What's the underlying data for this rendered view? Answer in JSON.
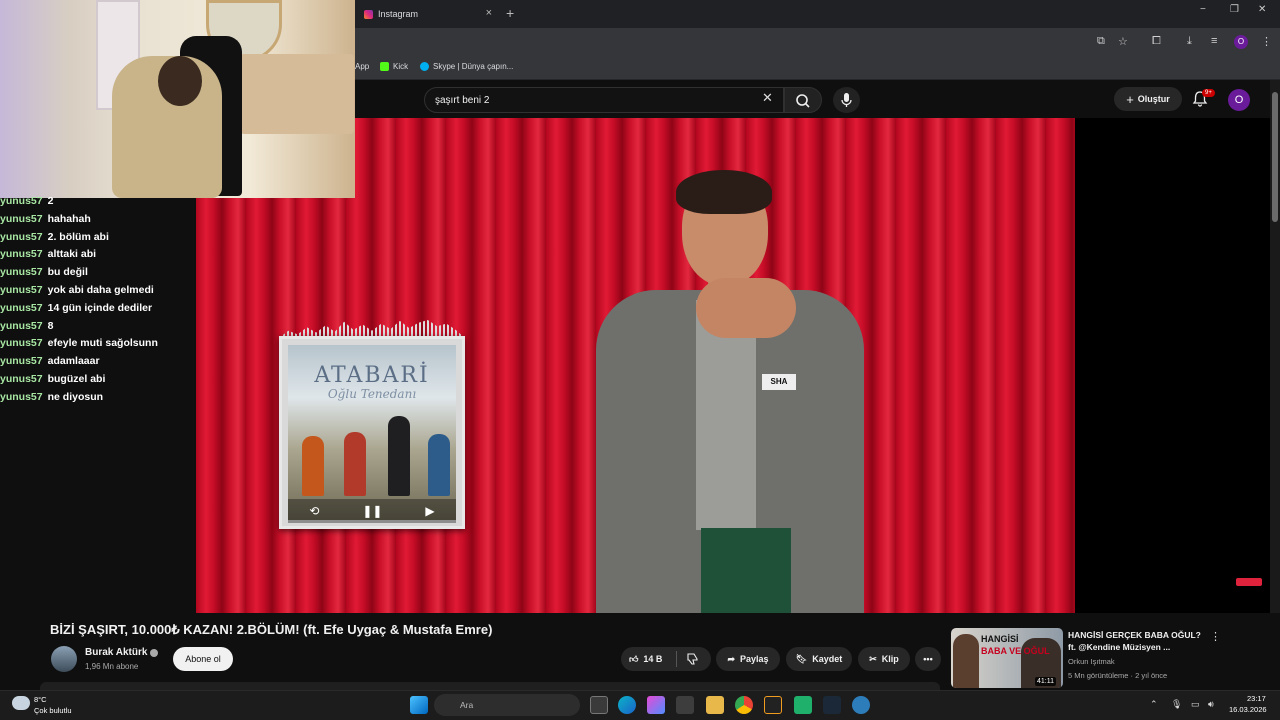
{
  "browser": {
    "tab_title": "Instagram",
    "new_tab": "+",
    "tab_close": "×",
    "window_controls": [
      "−",
      "❐",
      "✕"
    ],
    "bookmarks": [
      "App",
      "Kick",
      "Skype | Dünya çapın..."
    ],
    "profile_initial": "O"
  },
  "youtube": {
    "search_query": "şaşırt beni 2",
    "create_label": "Oluştur",
    "notifications_badge": "9+",
    "avatar_initial": "O"
  },
  "album": {
    "title": "ATABARİ",
    "subtitle": "Oğlu Tenedanı"
  },
  "chat": [
    {
      "user": "yunus57",
      "msg": "2"
    },
    {
      "user": "yunus57",
      "msg": "hahahah"
    },
    {
      "user": "yunus57",
      "msg": "2. bölüm abi"
    },
    {
      "user": "yunus57",
      "msg": "alttaki abi"
    },
    {
      "user": "yunus57",
      "msg": "bu değil"
    },
    {
      "user": "yunus57",
      "msg": "yok abi daha gelmedi"
    },
    {
      "user": "yunus57",
      "msg": "14 gün içinde dediler"
    },
    {
      "user": "yunus57",
      "msg": "8"
    },
    {
      "user": "yunus57",
      "msg": "efeyle muti sağolsunn"
    },
    {
      "user": "yunus57",
      "msg": "adamlaaar"
    },
    {
      "user": "yunus57",
      "msg": "bugüzel abi"
    },
    {
      "user": "yunus57",
      "msg": "ne diyosun"
    }
  ],
  "video": {
    "title": "BİZİ ŞAŞIRT, 10.000₺ KAZAN! 2.BÖLÜM! (ft. Efe Uygaç & Mustafa Emre)",
    "name_tag": "SHA",
    "channel_name": "Burak Aktürk",
    "channel_subs": "1,96 Mn abone",
    "subscribe_label": "Abone ol",
    "likes": "14 B",
    "share_label": "Paylaş",
    "save_label": "Kaydet",
    "clip_label": "Klip",
    "more_label": "•••"
  },
  "recommended": {
    "title": "HANGİSİ GERÇEK BABA OĞUL? ft. @Kendine Müzisyen ...",
    "channel": "Orkun Işıtmak",
    "meta": "5 Mn görüntüleme · 2 yıl önce",
    "duration": "41:11",
    "thumb_text1": "HANGİSİ",
    "thumb_text2": "BABA VE OĞUL"
  },
  "taskbar": {
    "temperature": "8°C",
    "weather": "Çok bulutlu",
    "search_placeholder": "Ara",
    "time": "23:17",
    "date": "16.03.2026"
  }
}
